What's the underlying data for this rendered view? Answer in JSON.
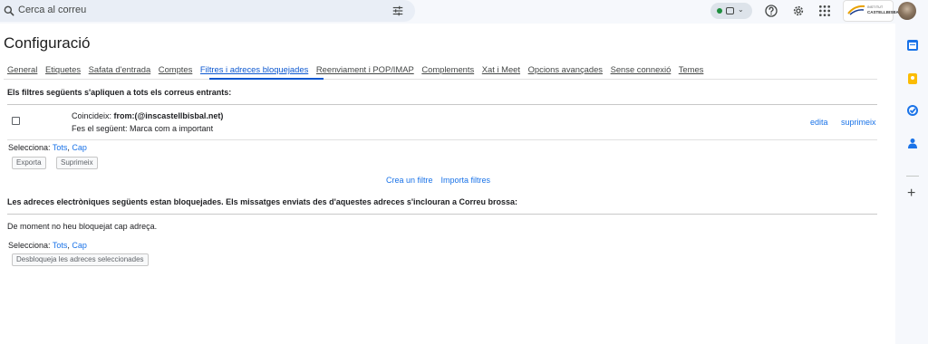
{
  "search": {
    "placeholder": "Cerca al correu"
  },
  "header": {
    "org_line1": "INSTITUT",
    "org_line2": "CASTELLBISBAL"
  },
  "page": {
    "title": "Configuració"
  },
  "tabs": [
    {
      "label": "General"
    },
    {
      "label": "Etiquetes"
    },
    {
      "label": "Safata d'entrada"
    },
    {
      "label": "Comptes"
    },
    {
      "label": "Filtres i adreces bloquejades",
      "active": true
    },
    {
      "label": "Reenviament i POP/IMAP"
    },
    {
      "label": "Complements"
    },
    {
      "label": "Xat i Meet"
    },
    {
      "label": "Opcions avançades"
    },
    {
      "label": "Sense connexió"
    },
    {
      "label": "Temes"
    }
  ],
  "filters": {
    "heading": "Els filtres següents s'apliquen a tots els correus entrants:",
    "rows": [
      {
        "match_label": "Coincideix: ",
        "match_value": "from:(@inscastellbisbal.net)",
        "action": "Fes el següent: Marca com a important",
        "edit": "edita",
        "delete": "suprimeix"
      }
    ],
    "select_label": "Selecciona: ",
    "select_all": "Tots",
    "select_sep": ", ",
    "select_none": "Cap",
    "export_button": "Exporta",
    "delete_button": "Suprimeix",
    "create_link": "Crea un filtre",
    "import_link": "Importa filtres"
  },
  "blocked": {
    "heading": "Les adreces electròniques següents estan bloquejades. Els missatges enviats des d'aquestes adreces s'inclouran a Correu brossa:",
    "empty_text": "De moment no heu bloquejat cap adreça.",
    "select_label": "Selecciona: ",
    "select_all": "Tots",
    "select_sep": ", ",
    "select_none": "Cap",
    "unblock_button": "Desbloqueja les adreces seleccionades"
  },
  "icons": {
    "search": "search-icon",
    "tune": "tune-icon",
    "status": "status-indicator",
    "help": "help-icon",
    "settings": "gear-icon",
    "apps": "apps-grid-icon",
    "calendar": "calendar-icon",
    "keep": "keep-icon",
    "tasks": "tasks-icon",
    "contacts": "contacts-icon",
    "add": "plus-icon"
  },
  "colors": {
    "accent": "#0b57d0",
    "link": "#1a73e8",
    "status_active": "#1e8e3e",
    "calendar": "#1a73e8",
    "keep": "#fbbc04",
    "tasks": "#1a73e8",
    "contacts": "#1a73e8"
  }
}
